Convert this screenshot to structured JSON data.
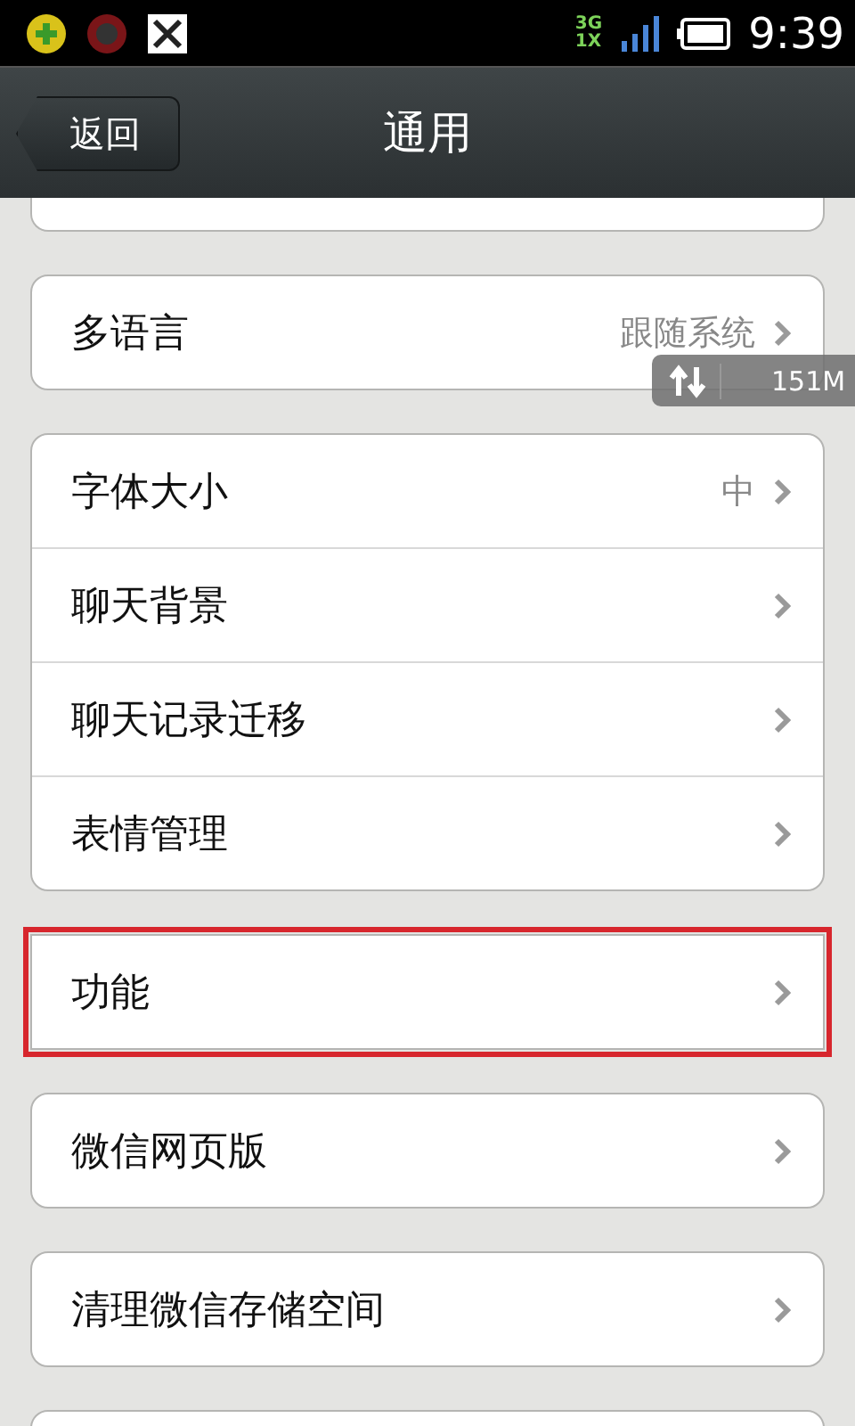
{
  "status_bar": {
    "network_top": "3G",
    "network_bottom": "1X",
    "time": "9:39"
  },
  "header": {
    "back": "返回",
    "title": "通用"
  },
  "groups": [
    {
      "rows": [
        {
          "label": "多语言",
          "value": "跟随系统",
          "highlighted": false
        }
      ]
    },
    {
      "rows": [
        {
          "label": "字体大小",
          "value": "中",
          "highlighted": false
        },
        {
          "label": "聊天背景",
          "highlighted": false
        },
        {
          "label": "聊天记录迁移",
          "highlighted": false
        },
        {
          "label": "表情管理",
          "highlighted": false
        }
      ]
    },
    {
      "rows": [
        {
          "label": "功能",
          "highlighted": true
        }
      ]
    },
    {
      "rows": [
        {
          "label": "微信网页版",
          "highlighted": false
        }
      ]
    },
    {
      "rows": [
        {
          "label": "清理微信存储空间",
          "highlighted": false
        }
      ]
    }
  ],
  "memory_widget": {
    "text": "151M"
  }
}
